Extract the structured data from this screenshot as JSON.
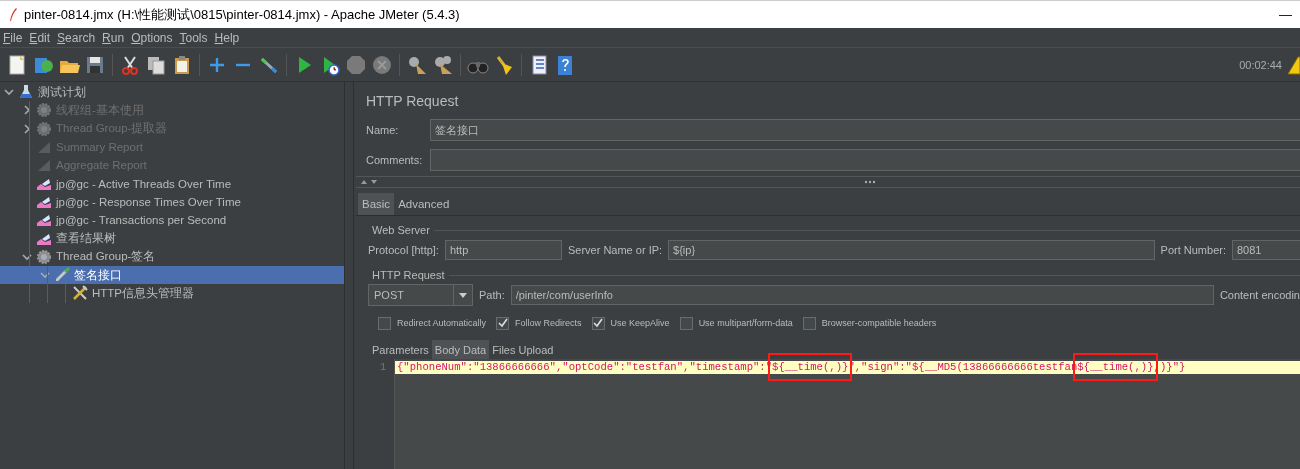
{
  "window": {
    "title": "pinter-0814.jmx (H:\\性能测试\\0815\\pinter-0814.jmx) - Apache JMeter (5.4.3)",
    "minimize": "—"
  },
  "menu": [
    "File",
    "Edit",
    "Search",
    "Run",
    "Options",
    "Tools",
    "Help"
  ],
  "toolbar": {
    "timer": "00:02:44"
  },
  "tree": [
    {
      "label": "测试计划",
      "kind": "plan",
      "disabled": false,
      "selected": false,
      "expanded": true,
      "children": [
        {
          "label": "线程组-基本使用",
          "kind": "thread-group",
          "disabled": true,
          "selected": false,
          "expanded": false
        },
        {
          "label": "Thread Group-提取器",
          "kind": "thread-group",
          "disabled": true,
          "selected": false,
          "expanded": false
        },
        {
          "label": "Summary Report",
          "kind": "report",
          "disabled": true,
          "selected": false
        },
        {
          "label": "Aggregate Report",
          "kind": "report",
          "disabled": true,
          "selected": false
        },
        {
          "label": "jp@gc - Active Threads Over Time",
          "kind": "graph",
          "disabled": false,
          "selected": false
        },
        {
          "label": "jp@gc - Response Times Over Time",
          "kind": "graph",
          "disabled": false,
          "selected": false
        },
        {
          "label": "jp@gc - Transactions per Second",
          "kind": "graph",
          "disabled": false,
          "selected": false
        },
        {
          "label": "查看结果树",
          "kind": "graph",
          "disabled": false,
          "selected": false
        },
        {
          "label": "Thread Group-签名",
          "kind": "thread-group",
          "disabled": false,
          "selected": false,
          "expanded": true,
          "children": [
            {
              "label": "签名接口",
              "kind": "sampler",
              "disabled": false,
              "selected": true,
              "expanded": true,
              "children": [
                {
                  "label": "HTTP信息头管理器",
                  "kind": "config",
                  "disabled": false,
                  "selected": false
                }
              ]
            }
          ]
        }
      ]
    }
  ],
  "panel": {
    "title": "HTTP Request",
    "name": {
      "label": "Name:",
      "value": "签名接口"
    },
    "comments": {
      "label": "Comments:"
    },
    "tabs": [
      {
        "label": "Basic",
        "selected": true
      },
      {
        "label": "Advanced",
        "selected": false
      }
    ],
    "web_server": {
      "title": "Web Server",
      "protocol": {
        "label": "Protocol [http]:",
        "value": "http"
      },
      "server": {
        "label": "Server Name or IP:",
        "value": "${ip}"
      },
      "port": {
        "label": "Port Number:",
        "value": "8081"
      }
    },
    "http_request": {
      "title": "HTTP Request",
      "method": "POST",
      "path": {
        "label": "Path:",
        "value": "/pinter/com/userInfo"
      },
      "content_encoding": {
        "label": "Content encodin"
      }
    },
    "options": [
      {
        "label": "Redirect Automatically",
        "checked": false
      },
      {
        "label": "Follow Redirects",
        "checked": true
      },
      {
        "label": "Use KeepAlive",
        "checked": true
      },
      {
        "label": "Use multipart/form-data",
        "checked": false
      },
      {
        "label": "Browser-compatible headers",
        "checked": false
      }
    ],
    "body_tabs": [
      {
        "label": "Parameters",
        "selected": false
      },
      {
        "label": "Body Data",
        "selected": true
      },
      {
        "label": "Files Upload",
        "selected": false
      }
    ],
    "editor": {
      "lines": [
        {
          "number": "1",
          "segments": [
            {
              "text": "{\"phoneNum\":\"13866666666\",\"optCode\":\"testfan\",\"timestamp\":\"",
              "boxed": false
            },
            {
              "text": "${__time(,)}",
              "boxed": true
            },
            {
              "text": "\",\"sign\":\"${__MD5(13866666666testfan",
              "boxed": false
            },
            {
              "text": "${__time(,)}",
              "boxed": true
            },
            {
              "text": ",)}\"}",
              "boxed": false
            }
          ]
        }
      ]
    }
  }
}
